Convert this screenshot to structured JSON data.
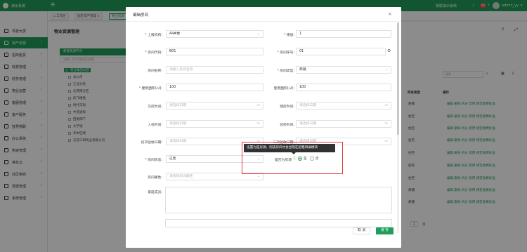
{
  "app": {
    "name": "演示系统",
    "user_org": "物联演示系统",
    "badge": "99",
    "user": "admin_yy"
  },
  "tabs": [
    "工作台",
    "固定资产管理",
    "物业资源"
  ],
  "sidebar": [
    "驾驶大屏",
    "资产资源",
    "招商租赁",
    "收费管理",
    "财务管理",
    "物业运营",
    "客服管理",
    "客户服务",
    "智慧物联",
    "办公系统",
    "物资管理",
    "停车云",
    "社区电商",
    "党建管理",
    "系统管理"
  ],
  "page": {
    "title": "物业资源管理",
    "tree_header": "新建资源节点",
    "tree_search": "请输入节点名称进行搜索",
    "tree": [
      "物业集团总部",
      "总公司",
      "江北分校",
      "北苑南分区",
      "凤飞楼盘",
      "时代天街",
      "中浩通商",
      "西驰御下",
      "大学城",
      "华中区域",
      "东莞三和商业有限公司"
    ],
    "search_placeholder": "搜索",
    "cols": [
      "所有类型",
      "操作"
    ],
    "col_mid": "层",
    "types": [
      "商铺",
      "住宅",
      "住宅",
      "住宅",
      "住宅",
      "住宅",
      "住宅",
      "商铺",
      "商铺"
    ],
    "ops_text": "编辑 删除 拆分 禁用 绑定收费标准",
    "small_nums": [
      "1",
      "5",
      "5"
    ],
    "page_goto": "页"
  },
  "modal": {
    "title": "编辑房间",
    "fields": {
      "parent": {
        "label": "上级机构:",
        "value": "A4#楼"
      },
      "floor": {
        "label": "楼层:",
        "value": "1"
      },
      "room_code": {
        "label": "房间代码:",
        "value": "B01"
      },
      "room_no": {
        "label": "房间序号:",
        "value": "01"
      },
      "room_name": {
        "label": "房间名称:",
        "placeholder": "请输入房间名称"
      },
      "room_type": {
        "label": "房间类型:",
        "value": "商铺"
      },
      "build_area": {
        "label": "建筑面积(㎡):",
        "value": "100"
      },
      "use_area": {
        "label": "使用面积(㎡):",
        "value": "100"
      },
      "deliver_time": {
        "label": "交房时间:",
        "placeholder": "请选择日期"
      },
      "build_time": {
        "label": "建房时间:",
        "placeholder": "请选择日期"
      },
      "checkin_time": {
        "label": "入住时间:",
        "placeholder": "请选择日期"
      },
      "decorate_time": {
        "label": "装修时间:",
        "placeholder": "请选择日期"
      },
      "first_accept": {
        "label": "初次验收日期:",
        "placeholder": "请选择日期"
      },
      "second_accept": {
        "label": "二次验收日期:",
        "placeholder": "请选择日期"
      },
      "status": {
        "label": "房间状态:",
        "value": "已售"
      },
      "is_room": {
        "label": "是否为房源",
        "yes": "是",
        "no": "否",
        "selected": "是"
      },
      "attr": {
        "label": "房间属性:",
        "placeholder": "请选择房间属性"
      },
      "members": {
        "label": "家庭成员:"
      }
    },
    "tooltip": "设置为是房源，则该房间才会出现在招租目录模块",
    "cancel": "取 消",
    "save": "保 存"
  },
  "colors": {
    "brand": "#1f9d5a",
    "danger": "#e53935"
  }
}
